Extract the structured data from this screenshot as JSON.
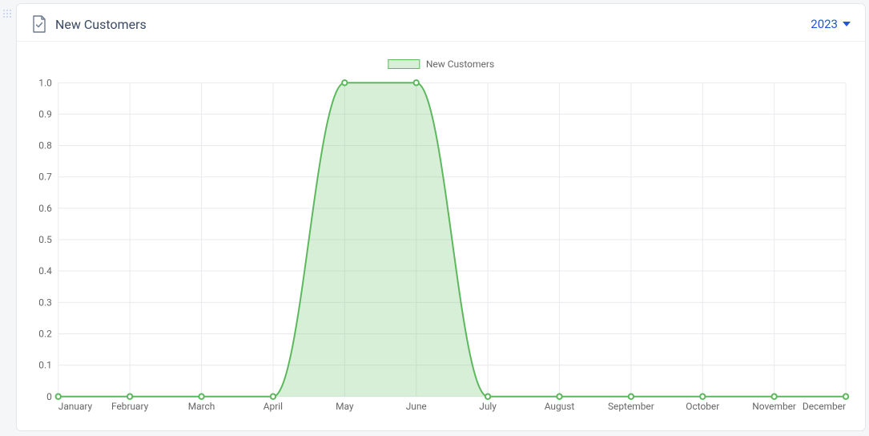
{
  "header": {
    "title": "New Customers",
    "year_label": "2023"
  },
  "legend": {
    "series_label": "New Customers"
  },
  "chart_data": {
    "type": "area",
    "categories": [
      "January",
      "February",
      "March",
      "April",
      "May",
      "June",
      "July",
      "August",
      "September",
      "October",
      "November",
      "December"
    ],
    "series": [
      {
        "name": "New Customers",
        "values": [
          0,
          0,
          0,
          0,
          1,
          1,
          0,
          0,
          0,
          0,
          0,
          0
        ]
      }
    ],
    "ylabel": "",
    "xlabel": "",
    "ylim": [
      0,
      1.0
    ],
    "yticks": [
      0,
      0.1,
      0.2,
      0.3,
      0.4,
      0.5,
      0.6,
      0.7,
      0.8,
      0.9,
      1.0
    ],
    "colors": {
      "series_stroke": "#5cb85c",
      "series_fill": "rgba(130,202,130,0.32)"
    }
  }
}
